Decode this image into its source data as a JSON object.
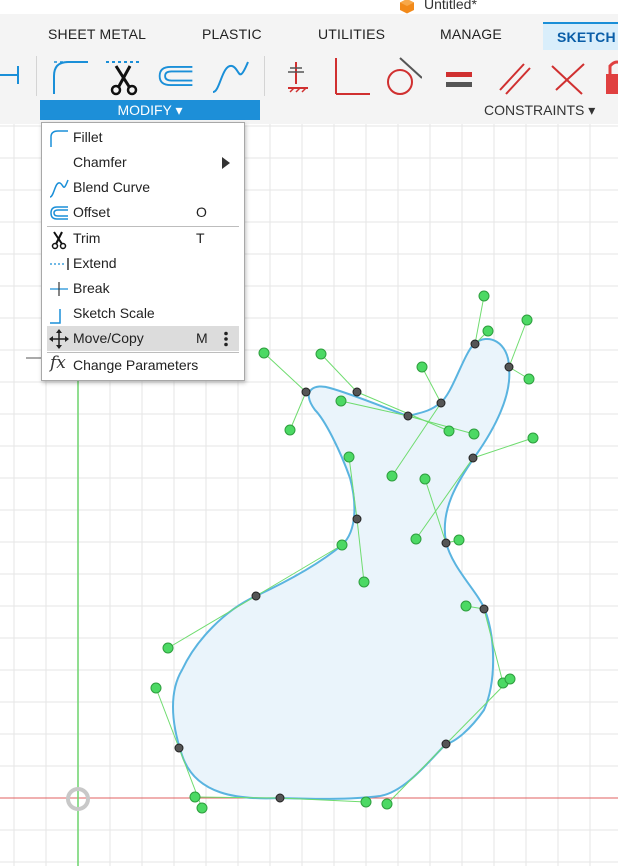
{
  "window": {
    "title": "Untitled*"
  },
  "tabs": [
    {
      "label": "SHEET METAL"
    },
    {
      "label": "PLASTIC"
    },
    {
      "label": "UTILITIES"
    },
    {
      "label": "MANAGE"
    },
    {
      "label": "SKETCH",
      "active": true
    }
  ],
  "ribbon": {
    "modify_label": "MODIFY ▾",
    "constraints_label": "CONSTRAINTS ▾"
  },
  "menu": {
    "items": [
      {
        "label": "Fillet",
        "shortcut": "",
        "icon": "fillet-icon"
      },
      {
        "label": "Chamfer",
        "shortcut": "",
        "icon": "chamfer-icon",
        "submenu": true
      },
      {
        "label": "Blend Curve",
        "shortcut": "",
        "icon": "blend-curve-icon"
      },
      {
        "label": "Offset",
        "shortcut": "O",
        "icon": "offset-icon"
      },
      {
        "label": "Trim",
        "shortcut": "T",
        "icon": "trim-icon"
      },
      {
        "label": "Extend",
        "shortcut": "",
        "icon": "extend-icon"
      },
      {
        "label": "Break",
        "shortcut": "",
        "icon": "break-icon"
      },
      {
        "label": "Sketch Scale",
        "shortcut": "",
        "icon": "sketch-scale-icon"
      },
      {
        "label": "Move/Copy",
        "shortcut": "M",
        "icon": "move-copy-icon",
        "highlighted": true
      },
      {
        "label": "Change Parameters",
        "shortcut": "",
        "icon": "change-parameters-icon"
      }
    ]
  },
  "colors": {
    "accent": "#1d8fd8",
    "control_point": "#4cd964",
    "spline": "#5ab4e0",
    "fill": "#eaf4fb",
    "grid": "#e3e3e3",
    "x_axis": "#e06060",
    "y_axis": "#6dd46d"
  }
}
